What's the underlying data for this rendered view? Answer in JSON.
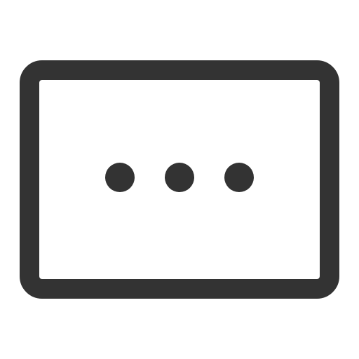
{
  "icon": {
    "name": "more-in-frame-icon",
    "stroke_color": "#333333",
    "dot_color": "#333333",
    "background_color": "#ffffff"
  }
}
